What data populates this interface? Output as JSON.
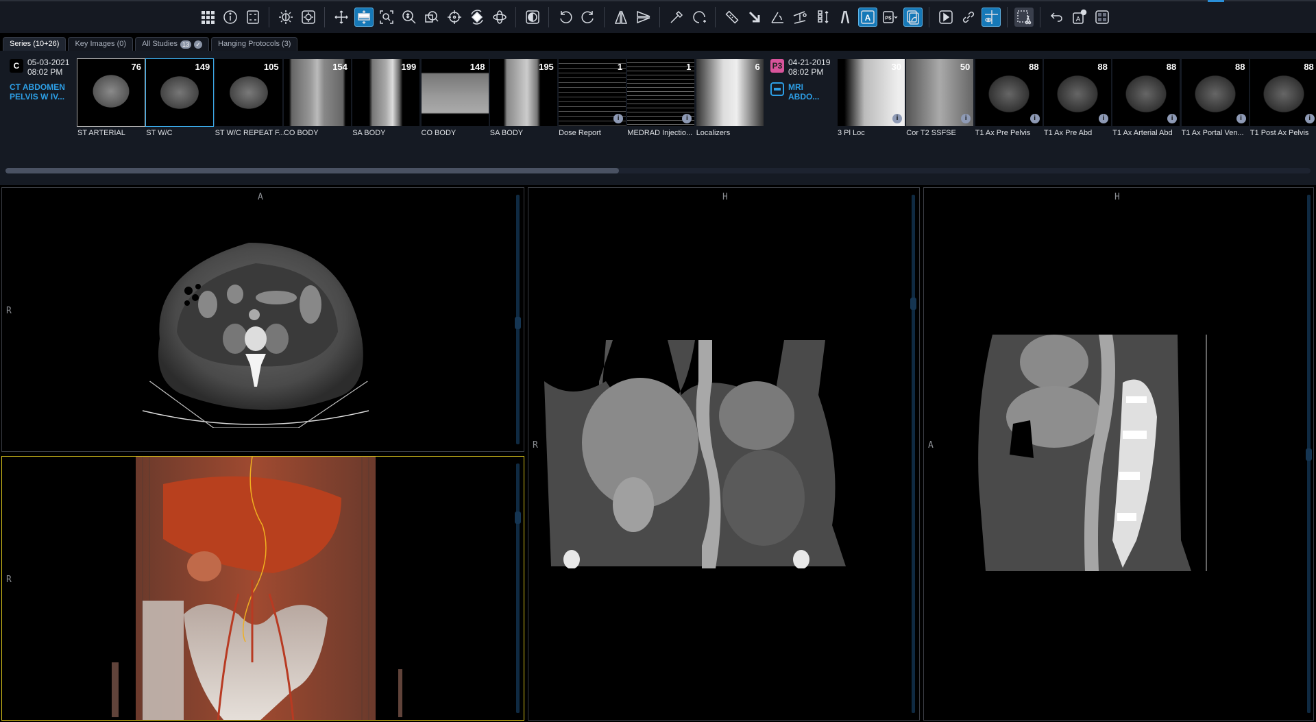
{
  "toolbar": {
    "icons": [
      "grid-icon",
      "info-icon",
      "layout-icon",
      "|",
      "brightness-icon",
      "window-level-icon",
      "|",
      "pan-icon",
      "stack-scroll-icon",
      "zoom-fit-icon",
      "magnify-icon",
      "zoom-region-icon",
      "crosshair-icon",
      "rotate-3d-icon",
      "orbit-icon",
      "|",
      "invert-icon",
      "|",
      "rotate-ccw-icon",
      "rotate-cw-icon",
      "|",
      "flip-horizontal-icon",
      "flip-vertical-icon",
      "|",
      "eyedropper-icon",
      "freehand-roi-icon",
      "|",
      "ruler-icon",
      "arrow-icon",
      "angle-icon",
      "cobb-angle-icon",
      "spine-label-icon",
      "vessel-icon",
      "annotation-icon",
      "ps-preset-icon",
      "presentation-icon",
      "|",
      "cine-play-icon",
      "link-icon",
      "reference-lines-icon",
      "|",
      "cut-icon",
      "|",
      "undo-icon",
      "clear-annotations-icon",
      "reset-layout-icon"
    ],
    "active": [
      "stack-scroll-icon",
      "annotation-icon",
      "presentation-icon",
      "reference-lines-icon"
    ],
    "annotation_letter": "A",
    "ps_label": "PS"
  },
  "tabs": [
    {
      "label": "Series (10+26)",
      "active": true
    },
    {
      "label": "Key Images (0)"
    },
    {
      "label": "All Studies",
      "badge": "13",
      "check": "✓"
    },
    {
      "label": "Hanging Protocols (3)"
    }
  ],
  "studies": [
    {
      "badge": "C",
      "badge_color": "#000000",
      "date": "05-03-2021",
      "time": "08:02 PM",
      "title1": "CT ABDOMEN",
      "title2": "PELVIS W IV...",
      "series": [
        {
          "count": "76",
          "label": "ST ARTERIAL"
        },
        {
          "count": "149",
          "label": "ST W/C"
        },
        {
          "count": "105",
          "label": "ST W/C REPEAT F..."
        },
        {
          "count": "154",
          "label": "CO BODY"
        },
        {
          "count": "199",
          "label": "SA BODY"
        },
        {
          "count": "148",
          "label": "CO BODY"
        },
        {
          "count": "195",
          "label": "SA BODY"
        },
        {
          "count": "1",
          "label": "Dose Report",
          "info": "i"
        },
        {
          "count": "1",
          "label": "MEDRAD Injectio...",
          "info": "i"
        },
        {
          "count": "6",
          "label": "Localizers"
        }
      ]
    },
    {
      "badge": "P3",
      "badge_color": "#d8549b",
      "date": "04-21-2019",
      "time": "08:02 PM",
      "title1": "MRI",
      "title2": "ABDO...",
      "series": [
        {
          "count": "30",
          "label": "3 Pl Loc",
          "info": "i"
        },
        {
          "count": "50",
          "label": "Cor T2 SSFSE",
          "info": "i"
        },
        {
          "count": "88",
          "label": "T1 Ax Pre Pelvis",
          "info": "i"
        },
        {
          "count": "88",
          "label": "T1 Ax Pre Abd",
          "info": "i"
        },
        {
          "count": "88",
          "label": "T1 Ax Arterial Abd",
          "info": "i"
        },
        {
          "count": "88",
          "label": "T1 Ax Portal Ven...",
          "info": "i"
        },
        {
          "count": "88",
          "label": "T1 Post Ax Pelvis",
          "info": "i"
        }
      ]
    }
  ],
  "viewports": {
    "axial": {
      "top": "A",
      "left": "R"
    },
    "volume": {
      "left": "R"
    },
    "coronal": {
      "top": "H",
      "left": "R"
    },
    "sagittal": {
      "top": "H",
      "left": "A"
    }
  },
  "scroll": {
    "strip_position_fraction": 0.47
  }
}
